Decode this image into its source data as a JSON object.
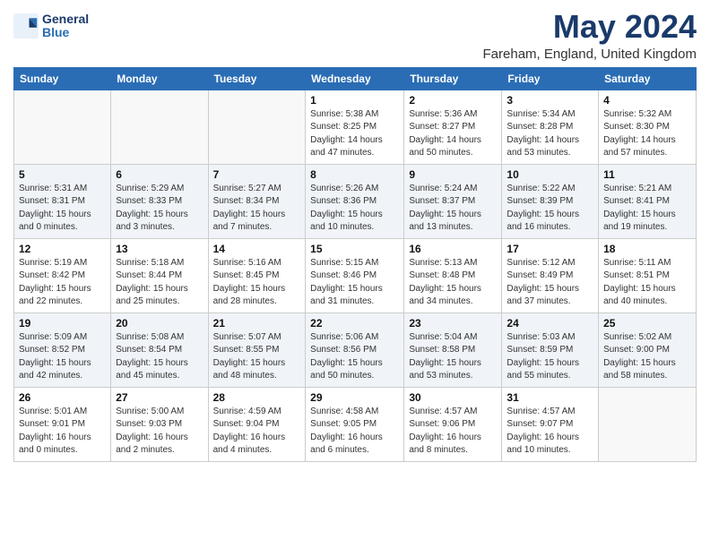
{
  "header": {
    "logo_line1": "General",
    "logo_line2": "Blue",
    "month": "May 2024",
    "location": "Fareham, England, United Kingdom"
  },
  "weekdays": [
    "Sunday",
    "Monday",
    "Tuesday",
    "Wednesday",
    "Thursday",
    "Friday",
    "Saturday"
  ],
  "weeks": [
    [
      {
        "day": "",
        "info": ""
      },
      {
        "day": "",
        "info": ""
      },
      {
        "day": "",
        "info": ""
      },
      {
        "day": "1",
        "info": "Sunrise: 5:38 AM\nSunset: 8:25 PM\nDaylight: 14 hours\nand 47 minutes."
      },
      {
        "day": "2",
        "info": "Sunrise: 5:36 AM\nSunset: 8:27 PM\nDaylight: 14 hours\nand 50 minutes."
      },
      {
        "day": "3",
        "info": "Sunrise: 5:34 AM\nSunset: 8:28 PM\nDaylight: 14 hours\nand 53 minutes."
      },
      {
        "day": "4",
        "info": "Sunrise: 5:32 AM\nSunset: 8:30 PM\nDaylight: 14 hours\nand 57 minutes."
      }
    ],
    [
      {
        "day": "5",
        "info": "Sunrise: 5:31 AM\nSunset: 8:31 PM\nDaylight: 15 hours\nand 0 minutes."
      },
      {
        "day": "6",
        "info": "Sunrise: 5:29 AM\nSunset: 8:33 PM\nDaylight: 15 hours\nand 3 minutes."
      },
      {
        "day": "7",
        "info": "Sunrise: 5:27 AM\nSunset: 8:34 PM\nDaylight: 15 hours\nand 7 minutes."
      },
      {
        "day": "8",
        "info": "Sunrise: 5:26 AM\nSunset: 8:36 PM\nDaylight: 15 hours\nand 10 minutes."
      },
      {
        "day": "9",
        "info": "Sunrise: 5:24 AM\nSunset: 8:37 PM\nDaylight: 15 hours\nand 13 minutes."
      },
      {
        "day": "10",
        "info": "Sunrise: 5:22 AM\nSunset: 8:39 PM\nDaylight: 15 hours\nand 16 minutes."
      },
      {
        "day": "11",
        "info": "Sunrise: 5:21 AM\nSunset: 8:41 PM\nDaylight: 15 hours\nand 19 minutes."
      }
    ],
    [
      {
        "day": "12",
        "info": "Sunrise: 5:19 AM\nSunset: 8:42 PM\nDaylight: 15 hours\nand 22 minutes."
      },
      {
        "day": "13",
        "info": "Sunrise: 5:18 AM\nSunset: 8:44 PM\nDaylight: 15 hours\nand 25 minutes."
      },
      {
        "day": "14",
        "info": "Sunrise: 5:16 AM\nSunset: 8:45 PM\nDaylight: 15 hours\nand 28 minutes."
      },
      {
        "day": "15",
        "info": "Sunrise: 5:15 AM\nSunset: 8:46 PM\nDaylight: 15 hours\nand 31 minutes."
      },
      {
        "day": "16",
        "info": "Sunrise: 5:13 AM\nSunset: 8:48 PM\nDaylight: 15 hours\nand 34 minutes."
      },
      {
        "day": "17",
        "info": "Sunrise: 5:12 AM\nSunset: 8:49 PM\nDaylight: 15 hours\nand 37 minutes."
      },
      {
        "day": "18",
        "info": "Sunrise: 5:11 AM\nSunset: 8:51 PM\nDaylight: 15 hours\nand 40 minutes."
      }
    ],
    [
      {
        "day": "19",
        "info": "Sunrise: 5:09 AM\nSunset: 8:52 PM\nDaylight: 15 hours\nand 42 minutes."
      },
      {
        "day": "20",
        "info": "Sunrise: 5:08 AM\nSunset: 8:54 PM\nDaylight: 15 hours\nand 45 minutes."
      },
      {
        "day": "21",
        "info": "Sunrise: 5:07 AM\nSunset: 8:55 PM\nDaylight: 15 hours\nand 48 minutes."
      },
      {
        "day": "22",
        "info": "Sunrise: 5:06 AM\nSunset: 8:56 PM\nDaylight: 15 hours\nand 50 minutes."
      },
      {
        "day": "23",
        "info": "Sunrise: 5:04 AM\nSunset: 8:58 PM\nDaylight: 15 hours\nand 53 minutes."
      },
      {
        "day": "24",
        "info": "Sunrise: 5:03 AM\nSunset: 8:59 PM\nDaylight: 15 hours\nand 55 minutes."
      },
      {
        "day": "25",
        "info": "Sunrise: 5:02 AM\nSunset: 9:00 PM\nDaylight: 15 hours\nand 58 minutes."
      }
    ],
    [
      {
        "day": "26",
        "info": "Sunrise: 5:01 AM\nSunset: 9:01 PM\nDaylight: 16 hours\nand 0 minutes."
      },
      {
        "day": "27",
        "info": "Sunrise: 5:00 AM\nSunset: 9:03 PM\nDaylight: 16 hours\nand 2 minutes."
      },
      {
        "day": "28",
        "info": "Sunrise: 4:59 AM\nSunset: 9:04 PM\nDaylight: 16 hours\nand 4 minutes."
      },
      {
        "day": "29",
        "info": "Sunrise: 4:58 AM\nSunset: 9:05 PM\nDaylight: 16 hours\nand 6 minutes."
      },
      {
        "day": "30",
        "info": "Sunrise: 4:57 AM\nSunset: 9:06 PM\nDaylight: 16 hours\nand 8 minutes."
      },
      {
        "day": "31",
        "info": "Sunrise: 4:57 AM\nSunset: 9:07 PM\nDaylight: 16 hours\nand 10 minutes."
      },
      {
        "day": "",
        "info": ""
      }
    ]
  ]
}
